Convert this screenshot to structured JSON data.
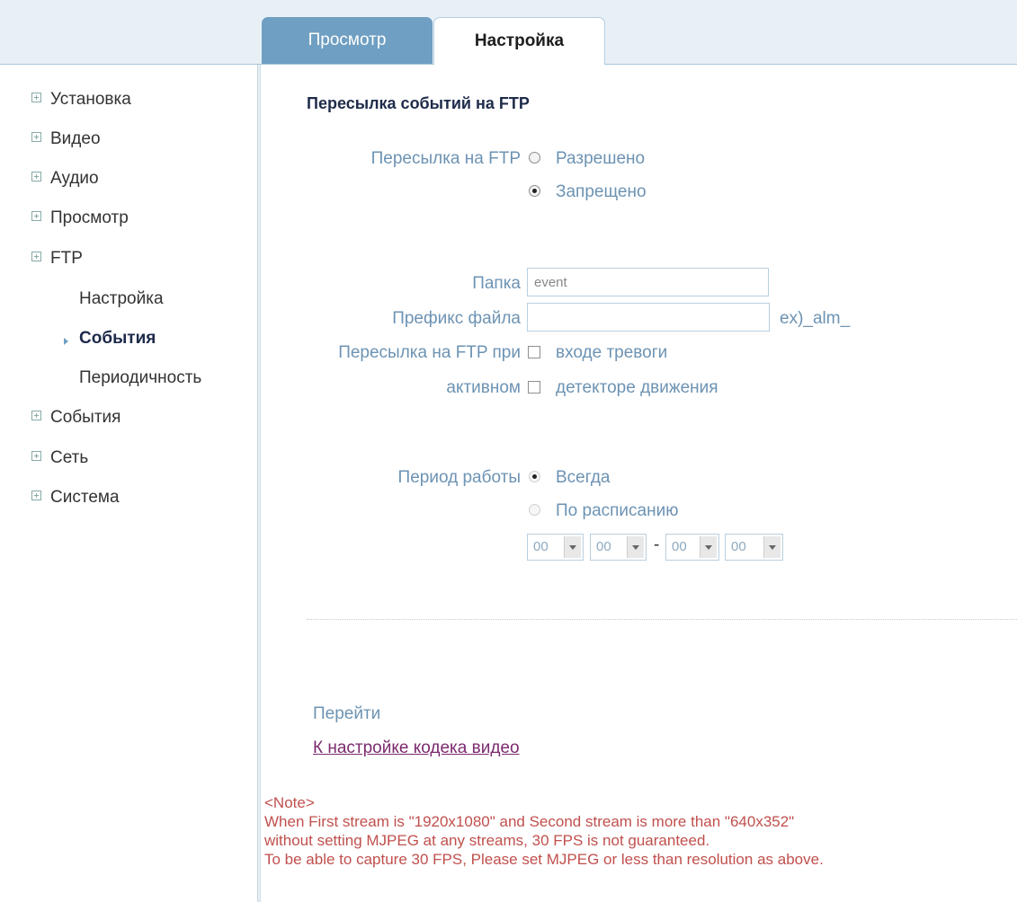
{
  "tabs": {
    "view": "Просмотр",
    "setup": "Настройка"
  },
  "sidebar": {
    "items": [
      "Установка",
      "Видео",
      "Аудио",
      "Просмотр",
      "FTP"
    ],
    "ftp_sub": [
      "Настройка",
      "События",
      "Периодичность"
    ],
    "items_after": [
      "События",
      "Сеть",
      "Система"
    ]
  },
  "main": {
    "title": "Пересылка событий на FTP",
    "ftp_upload": {
      "label": "Пересылка на FTP",
      "opt_on": "Разрешено",
      "opt_off": "Запрещено",
      "selected": "Запрещено"
    },
    "folder": {
      "label": "Папка",
      "value": "event"
    },
    "prefix": {
      "label": "Префикс файла",
      "value": "",
      "example": "ex)_alm_"
    },
    "upload_on": {
      "label": "Пересылка на FTP при",
      "opt1": "входе тревоги"
    },
    "active": {
      "label": "активном",
      "opt1": "детекторе движения"
    },
    "period": {
      "label": "Период работы",
      "opt_always": "Всегда",
      "opt_schedule": "По расписанию",
      "selected": "Всегда"
    },
    "time": {
      "h1": "00",
      "m1": "00",
      "dash": "-",
      "h2": "00",
      "m2": "00"
    },
    "goto": "Перейти",
    "link": "К настройке кодека видео",
    "note": {
      "l1": "<Note>",
      "l2": "When First stream is \"1920x1080\" and Second stream is more than \"640x352\"",
      "l3": "without setting MJPEG at any streams, 30 FPS is not guaranteed.",
      "l4": "To be able to capture 30 FPS, Please set MJPEG or less than resolution as above."
    }
  },
  "colors": {
    "accent": "#6f9fc2",
    "label": "#6d93b3",
    "note": "#c0504d",
    "link": "#7b2a6e",
    "title": "#1e2b4a"
  },
  "icons": {
    "tree": "plus-box-icon",
    "active_marker": "triangle-right-icon",
    "select_arrow": "chevron-down-icon"
  }
}
